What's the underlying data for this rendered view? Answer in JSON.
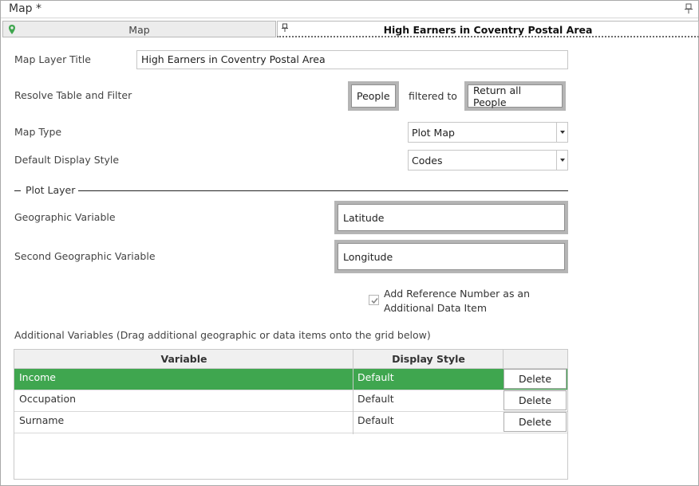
{
  "window": {
    "title": "Map *"
  },
  "tabs": [
    {
      "label": "Map"
    },
    {
      "label": "High Earners in Coventry Postal Area"
    }
  ],
  "form": {
    "layer_title_label": "Map Layer Title",
    "layer_title_value": "High Earners in Coventry Postal Area",
    "resolve_label": "Resolve Table and Filter",
    "resolve_table": "People",
    "filtered_to_text": "filtered to",
    "filter_value": "Return all People",
    "map_type_label": "Map Type",
    "map_type_value": "Plot Map",
    "display_style_label": "Default Display Style",
    "display_style_value": "Codes"
  },
  "plot_layer": {
    "section_title": "Plot Layer",
    "geo_var_label": "Geographic Variable",
    "geo_var_value": "Latitude",
    "second_geo_label": "Second Geographic Variable",
    "second_geo_value": "Longitude",
    "add_ref_checkbox_label": "Add Reference Number as an Additional Data Item",
    "add_ref_checked": true
  },
  "additional": {
    "instructions": "Additional Variables (Drag additional geographic or data items onto the grid below)",
    "columns": [
      "Variable",
      "Display Style",
      ""
    ],
    "rows": [
      {
        "variable": "Income",
        "display_style": "Default",
        "action": "Delete",
        "selected": true
      },
      {
        "variable": "Occupation",
        "display_style": "Default",
        "action": "Delete",
        "selected": false
      },
      {
        "variable": "Surname",
        "display_style": "Default",
        "action": "Delete",
        "selected": false
      }
    ]
  },
  "colors": {
    "selected_row": "#3fa64f",
    "map_marker": "#3fa64f"
  },
  "icons": {
    "window_pin": "pin-icon",
    "map_tab": "map-marker-icon",
    "layer_tab": "pin-icon"
  }
}
